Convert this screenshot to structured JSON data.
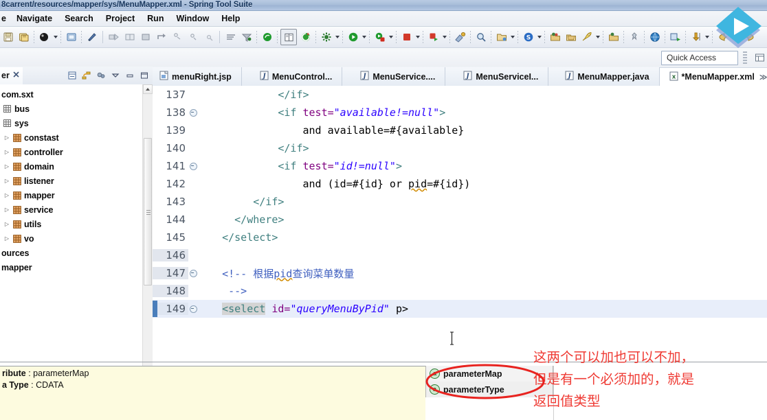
{
  "window": {
    "title": "8carrent/resources/mapper/sys/MenuMapper.xml - Spring Tool Suite"
  },
  "menubar": {
    "items": [
      {
        "label": "e"
      },
      {
        "label": "Navigate"
      },
      {
        "label": "Search"
      },
      {
        "label": "Project"
      },
      {
        "label": "Run"
      },
      {
        "label": "Window"
      },
      {
        "label": "Help"
      }
    ]
  },
  "toolbar": {
    "quick_access": "Quick Access",
    "icons": [
      "save-icon",
      "save-all-icon",
      "debug-icon",
      "print-icon",
      "new-icon",
      "run-step-icon",
      "columns-icon",
      "terminate-icon",
      "step-over-icon",
      "step-into-icon",
      "step-return-icon",
      "resume-icon",
      "toggle-icon",
      "filter-icon",
      "spring-icon",
      "open-type-icon",
      "refresh-icon",
      "build-icon",
      "run-as-icon",
      "debug-as-icon",
      "coverage-icon",
      "stop-icon",
      "profile-icon",
      "external-tools-icon",
      "search-icon",
      "new-folder-icon",
      "open-resource-icon",
      "package-icon",
      "java-icon",
      "rocket-icon",
      "annotation-icon",
      "globe-icon",
      "deploy-icon",
      "download-icon",
      "back-icon",
      "forward-icon"
    ]
  },
  "overlay": {
    "play_button": "play-overlay-icon",
    "accent": "#3fb6e0"
  },
  "left_view": {
    "tab_label": "er",
    "tab_close": "close-icon",
    "tools": [
      "collapse-all-icon",
      "link-editor-icon",
      "view-filter-icon",
      "view-menu-icon",
      "minimize-icon",
      "maximize-icon"
    ],
    "tree": [
      {
        "label": "com.sxt",
        "indent": 0,
        "twisty": "",
        "icon": "none"
      },
      {
        "label": "bus",
        "indent": 1,
        "twisty": "",
        "icon": "package-empty"
      },
      {
        "label": "sys",
        "indent": 1,
        "twisty": "",
        "icon": "package-empty"
      },
      {
        "label": "constast",
        "indent": 2,
        "twisty": "▷",
        "icon": "package"
      },
      {
        "label": "controller",
        "indent": 2,
        "twisty": "▷",
        "icon": "package"
      },
      {
        "label": "domain",
        "indent": 2,
        "twisty": "▷",
        "icon": "package"
      },
      {
        "label": "listener",
        "indent": 2,
        "twisty": "▷",
        "icon": "package"
      },
      {
        "label": "mapper",
        "indent": 2,
        "twisty": "▷",
        "icon": "package"
      },
      {
        "label": "service",
        "indent": 2,
        "twisty": "▷",
        "icon": "package"
      },
      {
        "label": "utils",
        "indent": 2,
        "twisty": "▷",
        "icon": "package"
      },
      {
        "label": "vo",
        "indent": 2,
        "twisty": "▷",
        "icon": "package"
      },
      {
        "label": "ources",
        "indent": 0,
        "twisty": "",
        "icon": "none"
      },
      {
        "label": "mapper",
        "indent": 0,
        "twisty": "",
        "icon": "none"
      }
    ]
  },
  "editor": {
    "tabs": [
      {
        "label": "menuRight.jsp",
        "icon": "jsp-file-icon",
        "active": false
      },
      {
        "label": "MenuControl...",
        "icon": "java-file-icon",
        "active": false
      },
      {
        "label": "MenuService....",
        "icon": "java-file-icon",
        "active": false
      },
      {
        "label": "MenuServiceI...",
        "icon": "java-file-icon",
        "active": false
      },
      {
        "label": "MenuMapper.java",
        "icon": "java-file-icon",
        "active": false
      },
      {
        "label": "*MenuMapper.xml",
        "icon": "xml-file-icon",
        "active": true
      }
    ],
    "lines": [
      {
        "num": "137",
        "fold": false,
        "shade": false,
        "current": false,
        "segments": [
          {
            "t": "            ",
            "c": "plain"
          },
          {
            "t": "</if>",
            "c": "tag"
          }
        ]
      },
      {
        "num": "138",
        "fold": true,
        "shade": false,
        "current": false,
        "segments": [
          {
            "t": "            ",
            "c": "plain"
          },
          {
            "t": "<if ",
            "c": "tag"
          },
          {
            "t": "test=",
            "c": "attr"
          },
          {
            "t": "\"available!=null\"",
            "c": "val"
          },
          {
            "t": ">",
            "c": "tag"
          }
        ]
      },
      {
        "num": "139",
        "fold": false,
        "shade": false,
        "current": false,
        "segments": [
          {
            "t": "                and available=#{available}",
            "c": "plain"
          }
        ]
      },
      {
        "num": "140",
        "fold": false,
        "shade": false,
        "current": false,
        "segments": [
          {
            "t": "            ",
            "c": "plain"
          },
          {
            "t": "</if>",
            "c": "tag"
          }
        ]
      },
      {
        "num": "141",
        "fold": true,
        "shade": false,
        "current": false,
        "segments": [
          {
            "t": "            ",
            "c": "plain"
          },
          {
            "t": "<if ",
            "c": "tag"
          },
          {
            "t": "test=",
            "c": "attr"
          },
          {
            "t": "\"id!=null\"",
            "c": "val"
          },
          {
            "t": ">",
            "c": "tag"
          }
        ]
      },
      {
        "num": "142",
        "fold": false,
        "shade": false,
        "current": false,
        "segments": [
          {
            "t": "                and (id=#{id} or ",
            "c": "plain"
          },
          {
            "t": "pid",
            "c": "squiggle"
          },
          {
            "t": "=#{id})",
            "c": "plain"
          }
        ]
      },
      {
        "num": "143",
        "fold": false,
        "shade": false,
        "current": false,
        "segments": [
          {
            "t": "        ",
            "c": "plain"
          },
          {
            "t": "</if>",
            "c": "tag"
          }
        ]
      },
      {
        "num": "144",
        "fold": false,
        "shade": false,
        "current": false,
        "segments": [
          {
            "t": "     ",
            "c": "plain"
          },
          {
            "t": "</where>",
            "c": "tag"
          }
        ]
      },
      {
        "num": "145",
        "fold": false,
        "shade": false,
        "current": false,
        "segments": [
          {
            "t": "   ",
            "c": "plain"
          },
          {
            "t": "</select>",
            "c": "tag"
          }
        ]
      },
      {
        "num": "146",
        "fold": false,
        "shade": true,
        "current": false,
        "segments": [
          {
            "t": "",
            "c": "plain"
          }
        ]
      },
      {
        "num": "147",
        "fold": true,
        "shade": true,
        "current": false,
        "segments": [
          {
            "t": "   ",
            "c": "plain"
          },
          {
            "t": "<!-- ",
            "c": "comment"
          },
          {
            "t": "根据",
            "c": "comment"
          },
          {
            "t": "pid",
            "c": "comment-squiggle"
          },
          {
            "t": "查询菜单数量",
            "c": "comment"
          }
        ]
      },
      {
        "num": "148",
        "fold": false,
        "shade": true,
        "current": false,
        "segments": [
          {
            "t": "    ",
            "c": "plain"
          },
          {
            "t": "-->",
            "c": "comment"
          }
        ]
      },
      {
        "num": "149",
        "fold": true,
        "shade": false,
        "current": true,
        "segments": [
          {
            "t": "   ",
            "c": "plain"
          },
          {
            "t": "<select",
            "c": "tag-sel"
          },
          {
            "t": " ",
            "c": "plain"
          },
          {
            "t": "id=",
            "c": "attr"
          },
          {
            "t": "\"queryMenuByPid\"",
            "c": "val"
          },
          {
            "t": " p>",
            "c": "plain"
          }
        ]
      }
    ]
  },
  "doc_panel": {
    "lines": [
      {
        "label": "ribute",
        "value": "parameterMap"
      },
      {
        "label": "a Type",
        "value": "CDATA"
      }
    ],
    "background": "#fdfbdf"
  },
  "content_assist": {
    "items": [
      {
        "label": "parameterMap",
        "icon": "attribute-icon"
      },
      {
        "label": "parameterType",
        "icon": "attribute-icon"
      }
    ]
  },
  "annotation": {
    "color": "#ef3b34",
    "lines": [
      "这两个可以加也可以不加，",
      "但是有一个必须加的，就是",
      "返回值类型"
    ],
    "ellipse": "red-ellipse-highlight"
  }
}
